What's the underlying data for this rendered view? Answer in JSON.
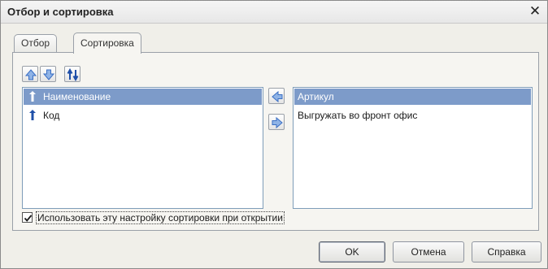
{
  "window": {
    "title": "Отбор и сортировка",
    "close_glyph": "✕"
  },
  "tabs": [
    {
      "label": "Отбор",
      "active": false
    },
    {
      "label": "Сортировка",
      "active": true
    }
  ],
  "toolbar": {
    "icons": [
      "move-up-icon",
      "move-down-icon",
      "sort-direction-icon"
    ]
  },
  "left_list": {
    "items": [
      {
        "label": "Наименование",
        "selected": true,
        "icon": "pin-icon"
      },
      {
        "label": "Код",
        "selected": false,
        "icon": "pin-icon"
      }
    ]
  },
  "right_list": {
    "items": [
      {
        "label": "Артикул",
        "selected": true
      },
      {
        "label": "Выгружать во фронт офис",
        "selected": false
      }
    ]
  },
  "move_buttons": {
    "icons": [
      "move-left-icon",
      "move-right-icon"
    ]
  },
  "option": {
    "label": "Использовать эту настройку сортировки при открытии",
    "checked": true
  },
  "buttons": {
    "ok": "OK",
    "cancel": "Отмена",
    "help": "Справка"
  },
  "colors": {
    "selection": "#7d9bc9",
    "arrow_blue": "#3b6fc4",
    "dialog_bg": "#f0efe9"
  }
}
